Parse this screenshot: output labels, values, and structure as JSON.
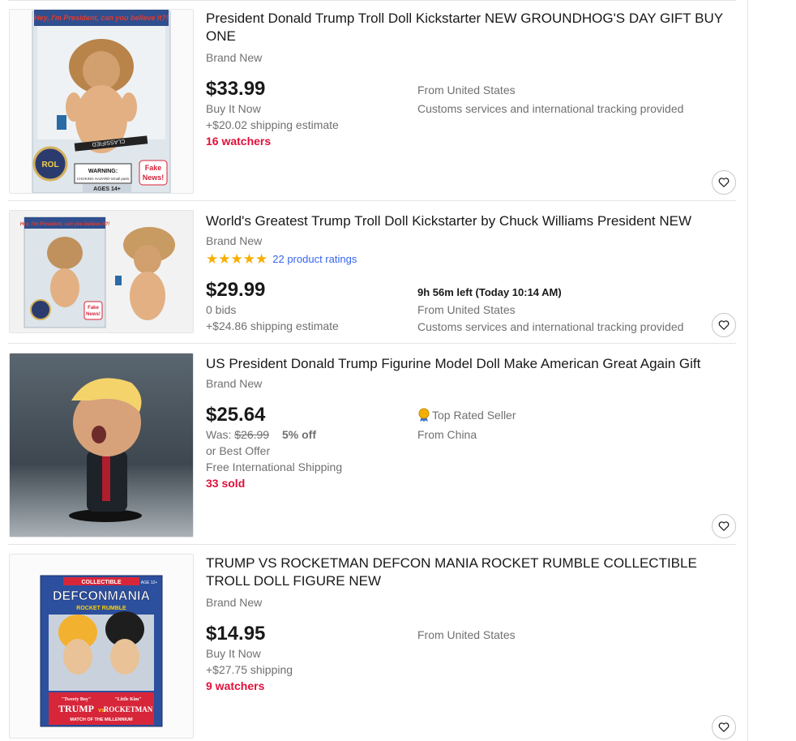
{
  "listings": [
    {
      "title": "President Donald Trump Troll Doll Kickstarter NEW GROUNDHOG'S DAY GIFT BUY ONE",
      "condition": "Brand New",
      "price": "$33.99",
      "format": "Buy It Now",
      "shipping": "+$20.02 shipping estimate",
      "watchers": "16 watchers",
      "location": "From United States",
      "customs": "Customs services and international tracking provided",
      "image_text": {
        "bubble": "Hey, I'm President, can you believe it?!",
        "classified": "CLASSIFIED",
        "warning": "WARNING:",
        "warning_small": "CHOKING HAZARD-Small parts",
        "fake_news": "Fake News!",
        "ages": "AGES 14+",
        "seal": "ROL"
      }
    },
    {
      "title": "World's Greatest Trump Troll Doll Kickstarter by Chuck Williams President NEW",
      "condition": "Brand New",
      "rating_count": "22 product ratings",
      "stars": 5,
      "price": "$29.99",
      "bids": "0 bids",
      "shipping": "+$24.86 shipping estimate",
      "time_left": "9h 56m left (Today 10:14 AM)",
      "location": "From United States",
      "customs": "Customs services and international tracking provided",
      "image_text": {
        "bubble": "Hey, I'm President, can you believe it?!",
        "fake_news": "Fake News!"
      }
    },
    {
      "title": "US President Donald Trump Figurine Model Doll Make American Great Again Gift",
      "condition": "Brand New",
      "price": "$25.64",
      "was_label": "Was:",
      "was_price": "$26.99",
      "discount": "5% off",
      "best_offer": "or Best Offer",
      "shipping": "Free International Shipping",
      "sold": "33 sold",
      "top_rated": "Top Rated Seller",
      "location": "From China"
    },
    {
      "title": "TRUMP VS ROCKETMAN DEFCON MANIA ROCKET RUMBLE COLLECTIBLE TROLL DOLL FIGURE NEW",
      "condition": "Brand New",
      "price": "$14.95",
      "format": "Buy It Now",
      "shipping": "+$27.75 shipping",
      "watchers": "9 watchers",
      "location": "From United States",
      "image_text": {
        "collectible": "COLLECTIBLE",
        "brand": "DEFCONMANIA",
        "subtitle": "ROCKET RUMBLE",
        "ages": "AGE 12+",
        "tweety": "\"Tweety Boy\"",
        "trump": "TRUMP",
        "vs": "vs",
        "little_kim": "\"Little Kim\"",
        "rocketman": "ROCKETMAN",
        "match": "MATCH OF THE MILLENNIUM"
      }
    }
  ],
  "colors": {
    "text": "#191919",
    "secondary": "#707070",
    "accent_red": "#e0103a",
    "link_blue": "#3665f3",
    "star": "#f5af02",
    "border": "#e5e5e5"
  }
}
